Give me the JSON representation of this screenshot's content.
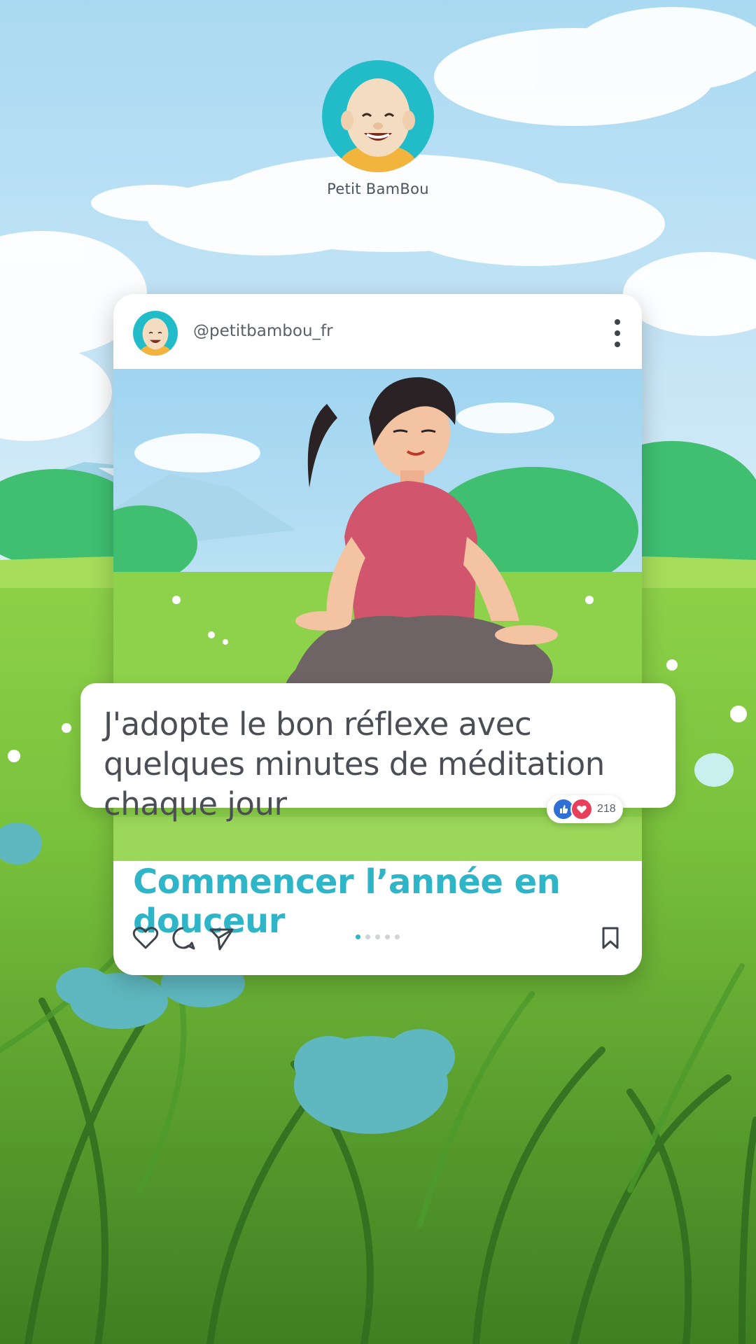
{
  "brand": {
    "name": "Petit BamBou"
  },
  "post": {
    "handle": "@petitbambou_fr",
    "caption": "J'adopte le bon réflexe avec quelques minutes de méditation chaque jour",
    "reaction_count": "218",
    "title": "Commencer l’année en douceur",
    "carousel": {
      "total": 5,
      "active": 1
    }
  },
  "icons": {
    "menu": "more-vertical-icon",
    "like": "heart-icon",
    "comment": "comment-bubble-icon",
    "share": "paper-plane-icon",
    "save": "bookmark-icon",
    "reactions": [
      "thumbs-up-icon",
      "heart-reaction-icon"
    ]
  },
  "colors": {
    "accent": "#2fb5c8",
    "avatar_bg": "#22bcc8",
    "shirt": "#d2556e"
  }
}
